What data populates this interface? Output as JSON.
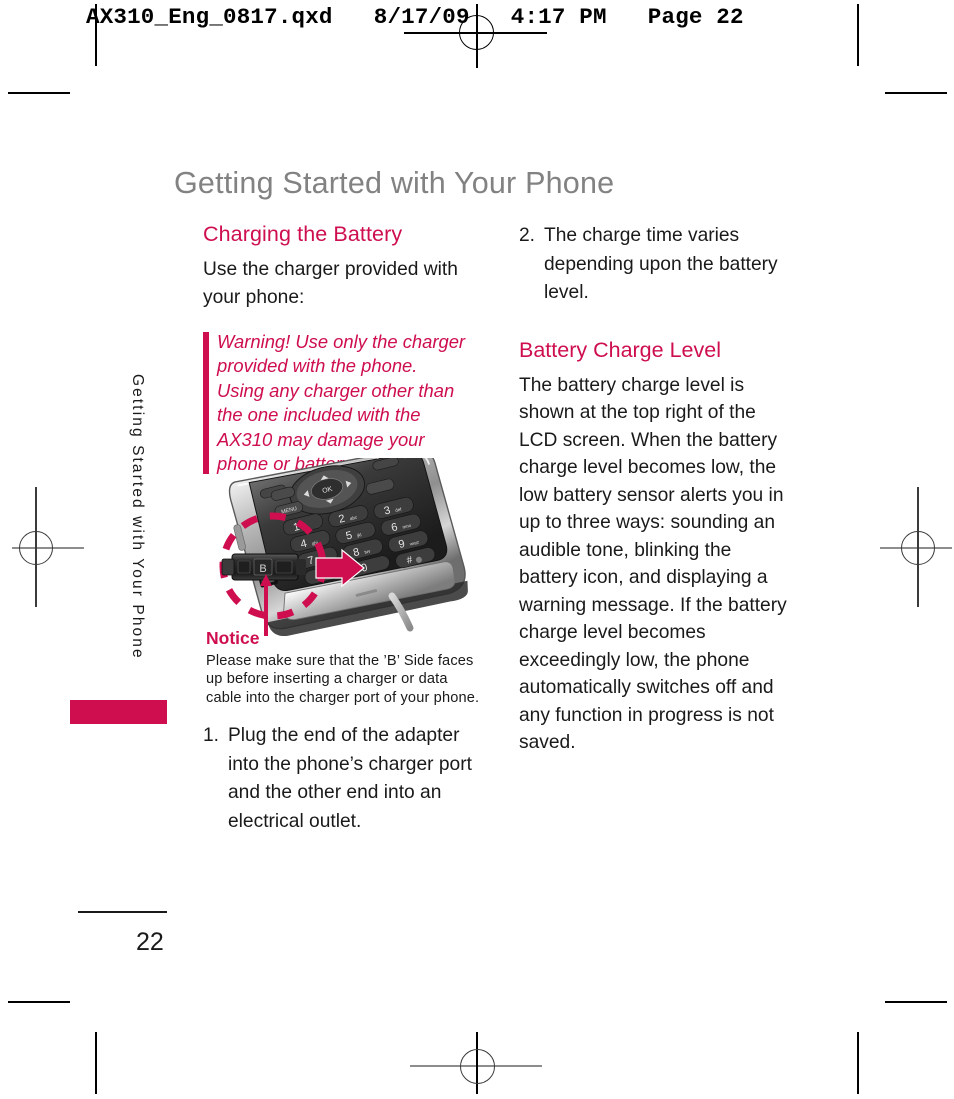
{
  "prepress": {
    "slug": "AX310_Eng_0817.qxd   8/17/09   4:17 PM   Page 22"
  },
  "page": {
    "chapter_title": "Getting Started with Your Phone",
    "running_head": "Getting Started with Your Phone",
    "page_number": "22",
    "accent_color": "#CE0E4E",
    "title_color": "#828282"
  },
  "left_column": {
    "section_heading": "Charging the Battery",
    "intro": "Use the charger provided with your phone:",
    "warning": "Warning! Use only the charger provided with the phone. Using any charger other than the one included with the AX310 may damage your phone or battery.",
    "notice": {
      "title": "Notice",
      "body": "Please make sure that the ’B’ Side faces up before inserting a charger or data cable into the charger port of your phone."
    },
    "step_1": {
      "number": "1.",
      "text": "Plug the end of the adapter into the phone’s charger port and the other end into an electrical outlet."
    }
  },
  "right_column": {
    "step_2": {
      "number": "2.",
      "text": "The charge time varies depending upon the battery level."
    },
    "section_heading": "Battery Charge Level",
    "body": "The battery charge level is shown at the top right of the LCD screen. When the battery charge level becomes low, the low battery sensor alerts you in up to three ways: sounding an audible tone, blinking the battery icon, and displaying a warning message. If the battery charge level becomes exceedingly low, the phone automatically switches off and any function in progress is not saved."
  },
  "illustration": {
    "description": "Grayscale photo of a mobile phone keypad with a dashed magenta circle highlighting the charger connector and a magenta arrow pointing to the charger port",
    "keypad_rows": [
      [
        "1",
        "2 abc",
        "3 def"
      ],
      [
        "4 ghi",
        "5 jkl",
        "6 mno"
      ],
      [
        "7 pqrs",
        "8 tuv",
        "9 wxyz"
      ],
      [
        "✻",
        "0",
        "#"
      ]
    ],
    "ok_key_label": "OK",
    "menu_key_label": "MENU"
  }
}
